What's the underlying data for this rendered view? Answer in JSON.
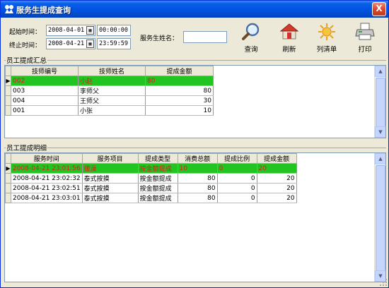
{
  "window": {
    "title": "服务生提成查询",
    "close_label": "X"
  },
  "filters": {
    "start_label": "起始时间：",
    "start_date": "2008-04-01",
    "start_time": "00:00:00",
    "end_label": "终止时间：",
    "end_date": "2008-04-21",
    "end_time": "23:59:59",
    "waiter_label": "服务生姓名：",
    "waiter_value": ""
  },
  "toolbar": {
    "query_label": "查询",
    "refresh_label": "刷新",
    "list_label": "列清单",
    "print_label": "打印"
  },
  "summary": {
    "title": "员工提成汇总",
    "columns": [
      "技师编号",
      "技师姓名",
      "提成金额"
    ],
    "rows": [
      [
        "002",
        "小赵",
        "80"
      ],
      [
        "003",
        "李师父",
        "80"
      ],
      [
        "004",
        "王师父",
        "30"
      ],
      [
        "001",
        "小张",
        "10"
      ]
    ]
  },
  "detail": {
    "title": "员工提成明细",
    "columns": [
      "服务时间",
      "服务项目",
      "提成类型",
      "消费总额",
      "提成比例",
      "提成金额"
    ],
    "rows": [
      [
        "2008-04-21 23:01:56",
        "搓澡",
        "按金额提成",
        "10",
        "0",
        "20"
      ],
      [
        "2008-04-21 23:02:32",
        "泰式按摸",
        "按金额提成",
        "80",
        "0",
        "20"
      ],
      [
        "2008-04-21 23:02:51",
        "泰式按摸",
        "按金额提成",
        "80",
        "0",
        "20"
      ],
      [
        "2008-04-21 23:03:01",
        "泰式按摸",
        "按金额提成",
        "80",
        "0",
        "20"
      ]
    ]
  },
  "icons": {
    "query": "magnifier-icon",
    "refresh": "house-refresh-icon",
    "list": "sun-list-icon",
    "print": "printer-icon"
  },
  "colors": {
    "selected_row_bg": "#21c421",
    "selected_row_text": "#d92020",
    "titlebar": "#0054e3"
  }
}
